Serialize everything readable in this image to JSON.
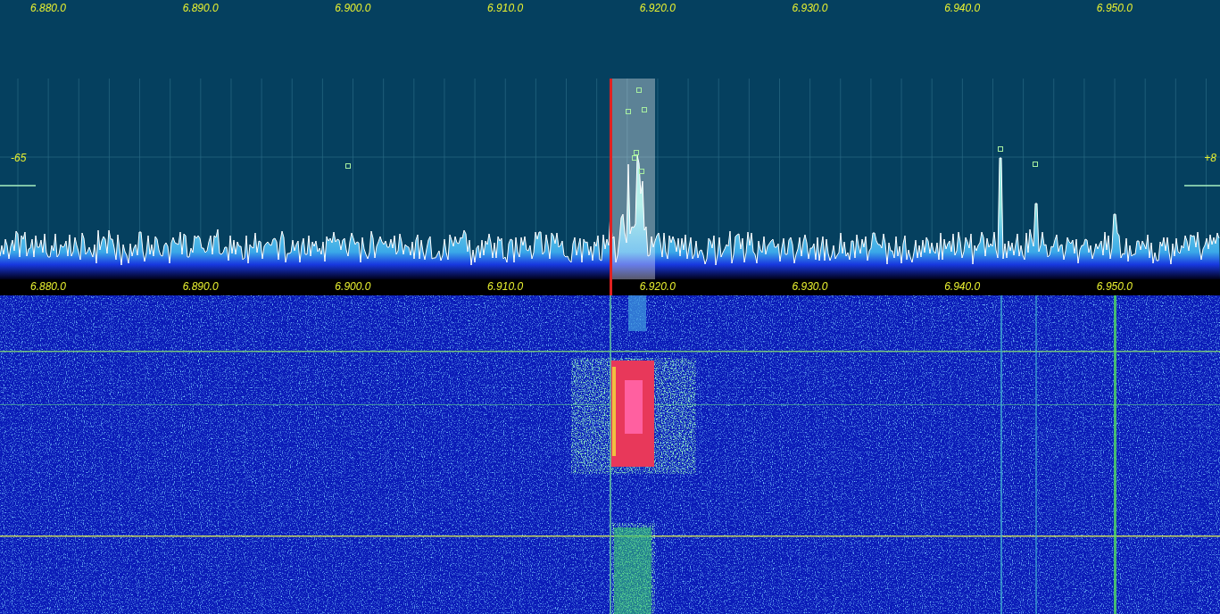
{
  "top_scale": {
    "labels": [
      "6.880.0",
      "6.890.0",
      "6.900.0",
      "6.910.0",
      "6.920.0",
      "6.930.0",
      "6.940.0",
      "6.950.0"
    ]
  },
  "spectrum": {
    "left_level_label": "-65",
    "right_level_label": "+8"
  },
  "bottom_scale": {
    "labels": [
      "6.880.0",
      "6.890.0",
      "6.900.0",
      "6.910.0",
      "6.920.0",
      "6.930.0",
      "6.940.0",
      "6.950.0"
    ]
  }
}
